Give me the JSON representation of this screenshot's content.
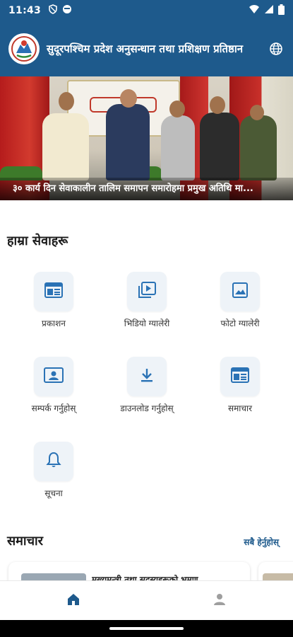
{
  "status_bar": {
    "time": "11:43",
    "icons": [
      "shield-icon",
      "face-icon",
      "wifi-icon",
      "signal-icon",
      "battery-icon"
    ]
  },
  "header": {
    "title": "सुदूरपश्चिम प्रदेश अनुसन्धान तथा प्रशिक्षण प्रतिष्ठान",
    "language_icon": "globe-icon",
    "color": "#1e5a8c"
  },
  "banner": {
    "caption": "३० कार्य दिन सेवाकालीन तालिम समापन समारोहमा प्रमुख अतिथि मा..."
  },
  "services": {
    "title": "हाम्रा सेवाहरू",
    "items": [
      {
        "label": "प्रकाशन",
        "icon": "publication-icon"
      },
      {
        "label": "भिडियो ग्यालेरी",
        "icon": "video-gallery-icon"
      },
      {
        "label": "फोटो ग्यालेरी",
        "icon": "photo-gallery-icon"
      },
      {
        "label": "सम्पर्क गर्नुहोस्",
        "icon": "contact-card-icon"
      },
      {
        "label": "डाउनलोड गर्नुहोस्",
        "icon": "download-icon"
      },
      {
        "label": "समाचार",
        "icon": "news-icon"
      },
      {
        "label": "सूचना",
        "icon": "bell-icon"
      }
    ]
  },
  "news": {
    "title": "समाचार",
    "see_all": "सबै हेर्नुहोस्",
    "first_card_title": "मुख्यमन्त्री तथा सदस्यहरूको भ्रमण"
  },
  "bottom_nav": {
    "items": [
      "home-icon",
      "profile-icon"
    ],
    "active": "home-icon"
  }
}
